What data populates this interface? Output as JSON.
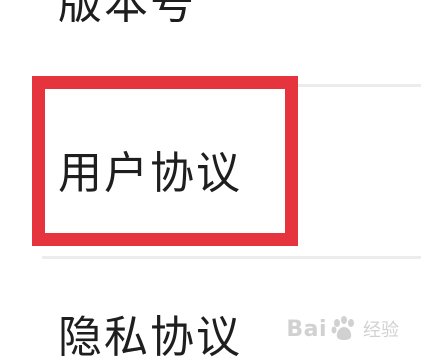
{
  "settings": {
    "items": [
      {
        "label": "版本号"
      },
      {
        "label": "用户协议"
      },
      {
        "label": "隐私协议"
      }
    ]
  },
  "annotation": {
    "highlight_color": "#e5343d",
    "highlighted_item": "用户协议"
  },
  "watermark": {
    "text_left": "Bai",
    "text_right": "经验"
  }
}
